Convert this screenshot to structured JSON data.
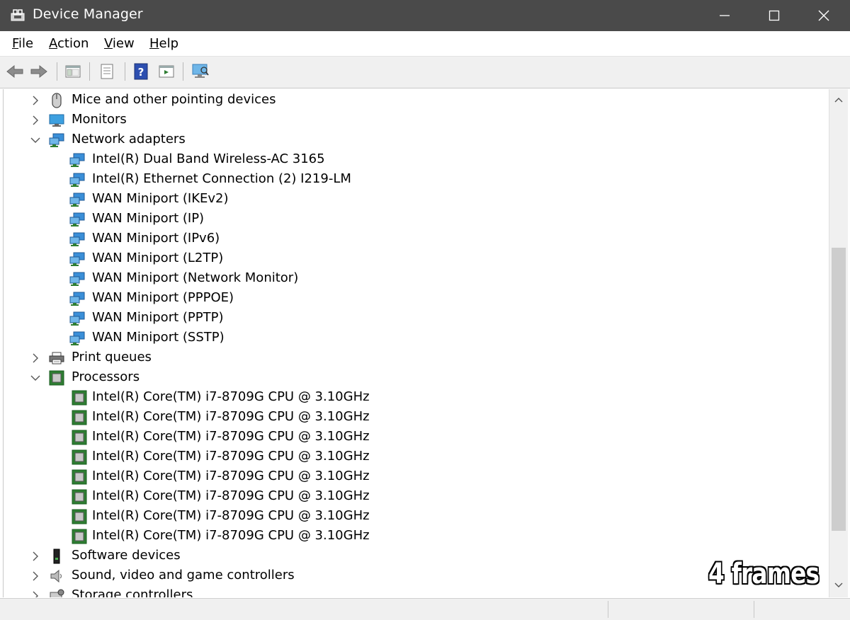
{
  "window": {
    "title": "Device Manager"
  },
  "menu": {
    "file": "ile",
    "file_key": "F",
    "action": "ction",
    "action_key": "A",
    "view": "iew",
    "view_key": "V",
    "help": "elp",
    "help_key": "H"
  },
  "tree": {
    "mice": "Mice and other pointing devices",
    "monitors": "Monitors",
    "network_adapters": "Network adapters",
    "net_children": [
      "Intel(R) Dual Band Wireless-AC 3165",
      "Intel(R) Ethernet Connection (2) I219-LM",
      "WAN Miniport (IKEv2)",
      "WAN Miniport (IP)",
      "WAN Miniport (IPv6)",
      "WAN Miniport (L2TP)",
      "WAN Miniport (Network Monitor)",
      "WAN Miniport (PPPOE)",
      "WAN Miniport (PPTP)",
      "WAN Miniport (SSTP)"
    ],
    "print_queues": "Print queues",
    "processors": "Processors",
    "cpu_children": [
      "Intel(R) Core(TM) i7-8709G CPU @ 3.10GHz",
      "Intel(R) Core(TM) i7-8709G CPU @ 3.10GHz",
      "Intel(R) Core(TM) i7-8709G CPU @ 3.10GHz",
      "Intel(R) Core(TM) i7-8709G CPU @ 3.10GHz",
      "Intel(R) Core(TM) i7-8709G CPU @ 3.10GHz",
      "Intel(R) Core(TM) i7-8709G CPU @ 3.10GHz",
      "Intel(R) Core(TM) i7-8709G CPU @ 3.10GHz",
      "Intel(R) Core(TM) i7-8709G CPU @ 3.10GHz"
    ],
    "software_devices": "Software devices",
    "sound": "Sound, video and game controllers",
    "storage": "Storage controllers"
  },
  "watermark": "4 frames",
  "colors": {
    "titlebar": "#4a4a4a",
    "toolbar": "#f0f0f0",
    "network_icon": "#3a8fd8",
    "cpu_icon": "#2e7d32"
  }
}
